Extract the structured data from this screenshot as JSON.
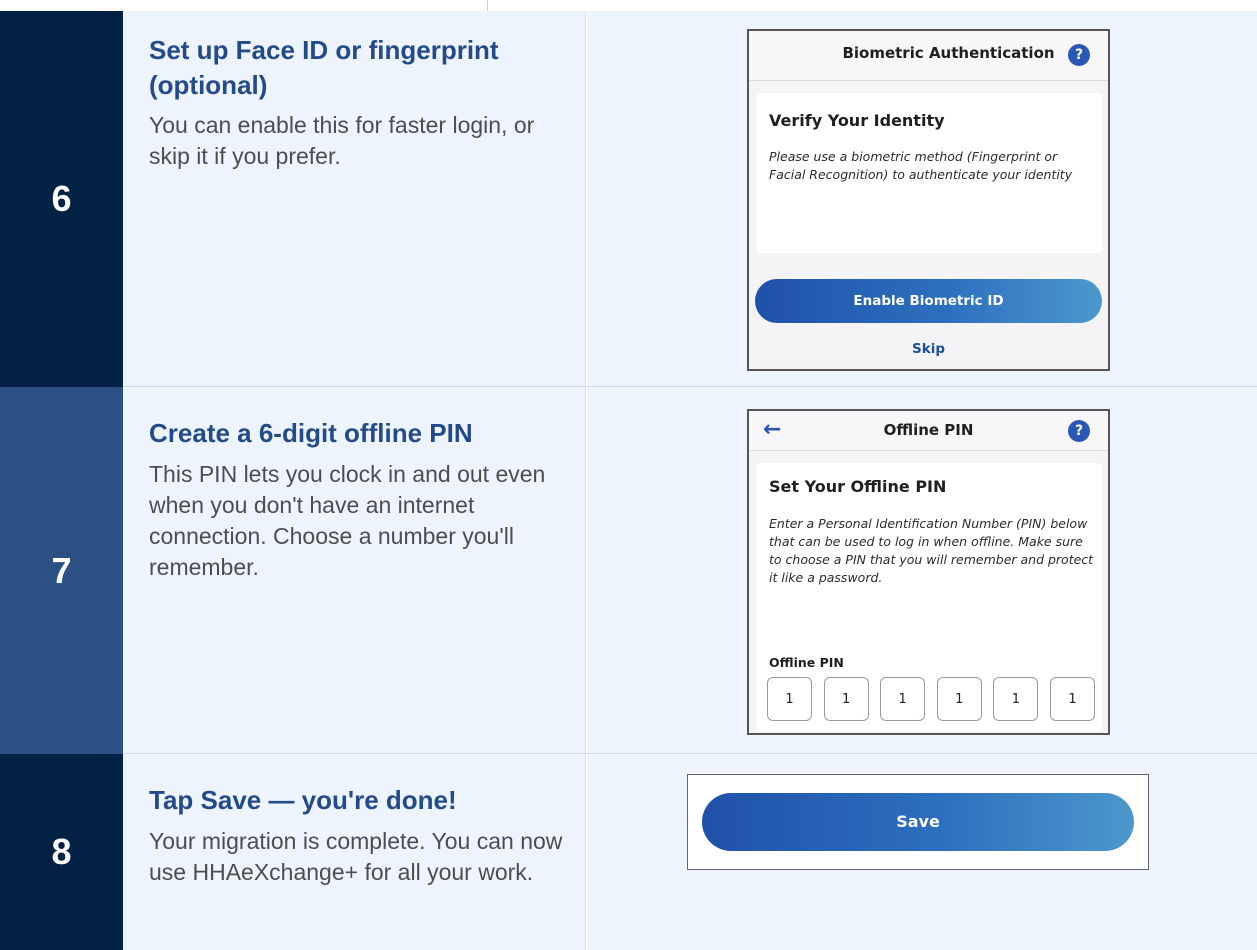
{
  "steps": [
    {
      "number": "6",
      "title": "Set up Face ID or fingerprint (optional)",
      "description": "You can enable this for faster login, or skip it if you prefer.",
      "screen": {
        "header_title": "Biometric Authentication",
        "help_icon": "?",
        "card_title": "Verify Your Identity",
        "card_body": "Please use a biometric method (Fingerprint or Facial Recognition) to authenticate your identity",
        "primary_button": "Enable Biometric ID",
        "secondary_link": "Skip"
      }
    },
    {
      "number": "7",
      "title": "Create a 6-digit offline PIN",
      "description": "This PIN lets you clock in and out even when you don't have an internet connection. Choose a number you'll remember.",
      "screen": {
        "back_icon": "←",
        "header_title": "Offline PIN",
        "help_icon": "?",
        "card_title": "Set Your Offline PIN",
        "card_body": "Enter a Personal Identification Number (PIN) below that can be used to log in when offline. Make sure to choose a PIN that you will remember and protect it like a password.",
        "pin_label": "Offline PIN",
        "pin_digits": [
          "1",
          "1",
          "1",
          "1",
          "1",
          "1"
        ]
      }
    },
    {
      "number": "8",
      "title": "Tap Save — you're done!",
      "description": "Your migration is complete. You can now use HHAeXchange+ for all your work.",
      "screen": {
        "save_button": "Save"
      }
    }
  ],
  "colors": {
    "number_dark": "#032144",
    "number_mid": "#2c4f84",
    "title": "#234b8a",
    "row_bg": "#eef4fd",
    "button_start": "#1f51a8",
    "button_end": "#4c98cc"
  }
}
